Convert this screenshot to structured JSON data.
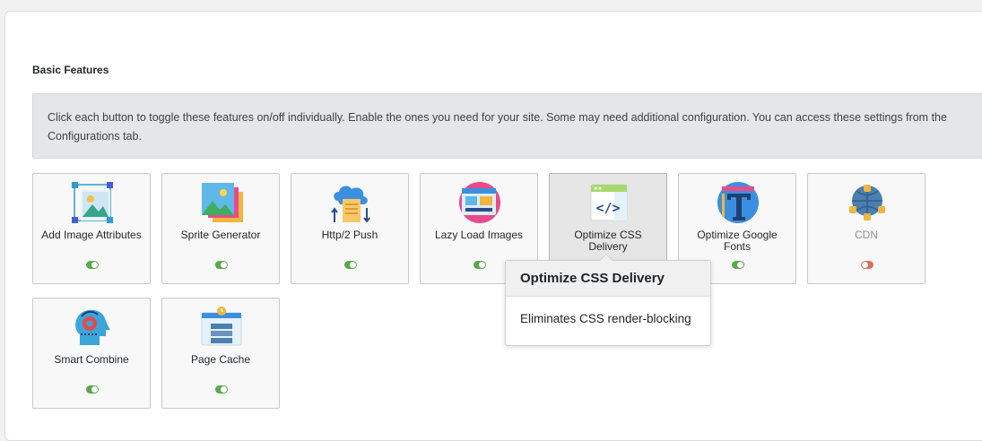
{
  "section": {
    "title": "Basic Features",
    "notice": "Click each button to toggle these features on/off individually. Enable the ones you need for your site. Some may need additional configuration. You can access these settings from the Configurations tab."
  },
  "features": [
    {
      "label": "Add Image Attributes",
      "icon": "image-attributes-icon",
      "enabled": true
    },
    {
      "label": "Sprite Generator",
      "icon": "sprite-generator-icon",
      "enabled": true
    },
    {
      "label": "Http/2 Push",
      "icon": "http2-push-icon",
      "enabled": true
    },
    {
      "label": "Lazy Load Images",
      "icon": "lazy-load-images-icon",
      "enabled": true
    },
    {
      "label": "Optimize CSS Delivery",
      "icon": "optimize-css-icon",
      "enabled": true
    },
    {
      "label": "Optimize Google Fonts",
      "icon": "google-fonts-icon",
      "enabled": true
    },
    {
      "label": "CDN",
      "icon": "cdn-icon",
      "enabled": false
    },
    {
      "label": "Smart Combine",
      "icon": "smart-combine-icon",
      "enabled": true
    },
    {
      "label": "Page Cache",
      "icon": "page-cache-icon",
      "enabled": true
    }
  ],
  "tooltip": {
    "title": "Optimize CSS Delivery",
    "body": "Eliminates CSS render-blocking"
  },
  "colors": {
    "toggle_on": "#5aa84c",
    "toggle_off": "#e06e5c"
  }
}
